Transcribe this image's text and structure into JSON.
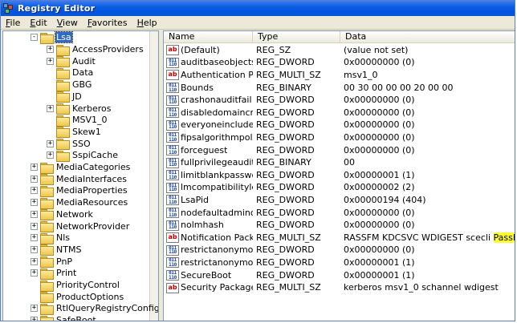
{
  "window": {
    "title": "Registry Editor"
  },
  "menu": [
    {
      "accel": "F",
      "rest": "ile"
    },
    {
      "accel": "E",
      "rest": "dit"
    },
    {
      "accel": "V",
      "rest": "iew"
    },
    {
      "accel": "",
      "rest": "Favorites",
      "pre": "F",
      "ul_index": 0
    },
    {
      "accel": "H",
      "rest": "elp"
    }
  ],
  "tree": {
    "items": [
      {
        "label": "Lsa",
        "indent": 1,
        "expander": "-",
        "selected": true
      },
      {
        "label": "AccessProviders",
        "indent": 2,
        "expander": "+"
      },
      {
        "label": "Audit",
        "indent": 2,
        "expander": "+"
      },
      {
        "label": "Data",
        "indent": 2,
        "expander": ""
      },
      {
        "label": "GBG",
        "indent": 2,
        "expander": ""
      },
      {
        "label": "JD",
        "indent": 2,
        "expander": ""
      },
      {
        "label": "Kerberos",
        "indent": 2,
        "expander": "+"
      },
      {
        "label": "MSV1_0",
        "indent": 2,
        "expander": ""
      },
      {
        "label": "Skew1",
        "indent": 2,
        "expander": ""
      },
      {
        "label": "SSO",
        "indent": 2,
        "expander": "+"
      },
      {
        "label": "SspiCache",
        "indent": 2,
        "expander": "+"
      },
      {
        "label": "MediaCategories",
        "indent": 1,
        "expander": "+"
      },
      {
        "label": "MediaInterfaces",
        "indent": 1,
        "expander": "+"
      },
      {
        "label": "MediaProperties",
        "indent": 1,
        "expander": "+"
      },
      {
        "label": "MediaResources",
        "indent": 1,
        "expander": "+"
      },
      {
        "label": "Network",
        "indent": 1,
        "expander": "+"
      },
      {
        "label": "NetworkProvider",
        "indent": 1,
        "expander": "+"
      },
      {
        "label": "Nls",
        "indent": 1,
        "expander": "+"
      },
      {
        "label": "NTMS",
        "indent": 1,
        "expander": "+"
      },
      {
        "label": "PnP",
        "indent": 1,
        "expander": "+"
      },
      {
        "label": "Print",
        "indent": 1,
        "expander": "+"
      },
      {
        "label": "PriorityControl",
        "indent": 1,
        "expander": ""
      },
      {
        "label": "ProductOptions",
        "indent": 1,
        "expander": ""
      },
      {
        "label": "RtlQueryRegistryConfig",
        "indent": 1,
        "expander": "+"
      },
      {
        "label": "SafeBoot",
        "indent": 1,
        "expander": "+"
      }
    ]
  },
  "list": {
    "columns": {
      "name": "Name",
      "type": "Type",
      "data": "Data"
    },
    "rows": [
      {
        "icon": "ab",
        "name": "(Default)",
        "type": "REG_SZ",
        "data": "(value not set)"
      },
      {
        "icon": "bin",
        "name": "auditbaseobjects",
        "type": "REG_DWORD",
        "data": "0x00000000 (0)"
      },
      {
        "icon": "ab",
        "name": "Authentication P...",
        "type": "REG_MULTI_SZ",
        "data": "msv1_0"
      },
      {
        "icon": "bin",
        "name": "Bounds",
        "type": "REG_BINARY",
        "data": "00 30 00 00 00 20 00 00"
      },
      {
        "icon": "bin",
        "name": "crashonauditfail",
        "type": "REG_DWORD",
        "data": "0x00000000 (0)"
      },
      {
        "icon": "bin",
        "name": "disabledomaincreds",
        "type": "REG_DWORD",
        "data": "0x00000000 (0)"
      },
      {
        "icon": "bin",
        "name": "everyoneincludes...",
        "type": "REG_DWORD",
        "data": "0x00000000 (0)"
      },
      {
        "icon": "bin",
        "name": "fipsalgorithmpolicy",
        "type": "REG_DWORD",
        "data": "0x00000000 (0)"
      },
      {
        "icon": "bin",
        "name": "forceguest",
        "type": "REG_DWORD",
        "data": "0x00000000 (0)"
      },
      {
        "icon": "bin",
        "name": "fullprivilegeauditing",
        "type": "REG_BINARY",
        "data": "00"
      },
      {
        "icon": "bin",
        "name": "limitblankpasswor...",
        "type": "REG_DWORD",
        "data": "0x00000001 (1)"
      },
      {
        "icon": "bin",
        "name": "lmcompatibilitylevel",
        "type": "REG_DWORD",
        "data": "0x00000002 (2)"
      },
      {
        "icon": "bin",
        "name": "LsaPid",
        "type": "REG_DWORD",
        "data": "0x00000194 (404)"
      },
      {
        "icon": "bin",
        "name": "nodefaultadmino...",
        "type": "REG_DWORD",
        "data": "0x00000000 (0)"
      },
      {
        "icon": "bin",
        "name": "nolmhash",
        "type": "REG_DWORD",
        "data": "0x00000000 (0)"
      },
      {
        "icon": "ab",
        "name": "Notification Pack...",
        "type": "REG_MULTI_SZ",
        "data": "RASSFM KDCSVC WDIGEST scecli",
        "data_highlight": "PassDump"
      },
      {
        "icon": "bin",
        "name": "restrictanonymous",
        "type": "REG_DWORD",
        "data": "0x00000000 (0)"
      },
      {
        "icon": "bin",
        "name": "restrictanonymous...",
        "type": "REG_DWORD",
        "data": "0x00000001 (1)"
      },
      {
        "icon": "bin",
        "name": "SecureBoot",
        "type": "REG_DWORD",
        "data": "0x00000001 (1)"
      },
      {
        "icon": "ab",
        "name": "Security Packages",
        "type": "REG_MULTI_SZ",
        "data": "kerberos msv1_0 schannel wdigest"
      }
    ]
  },
  "icons": {
    "string_glyph": "ab",
    "binary_glyph": "011\n110"
  },
  "colors": {
    "title_blue": "#0054e3",
    "selection": "#316ac5",
    "highlight": "#ffff33",
    "string_icon": "#c00000",
    "binary_icon": "#1040a8"
  }
}
